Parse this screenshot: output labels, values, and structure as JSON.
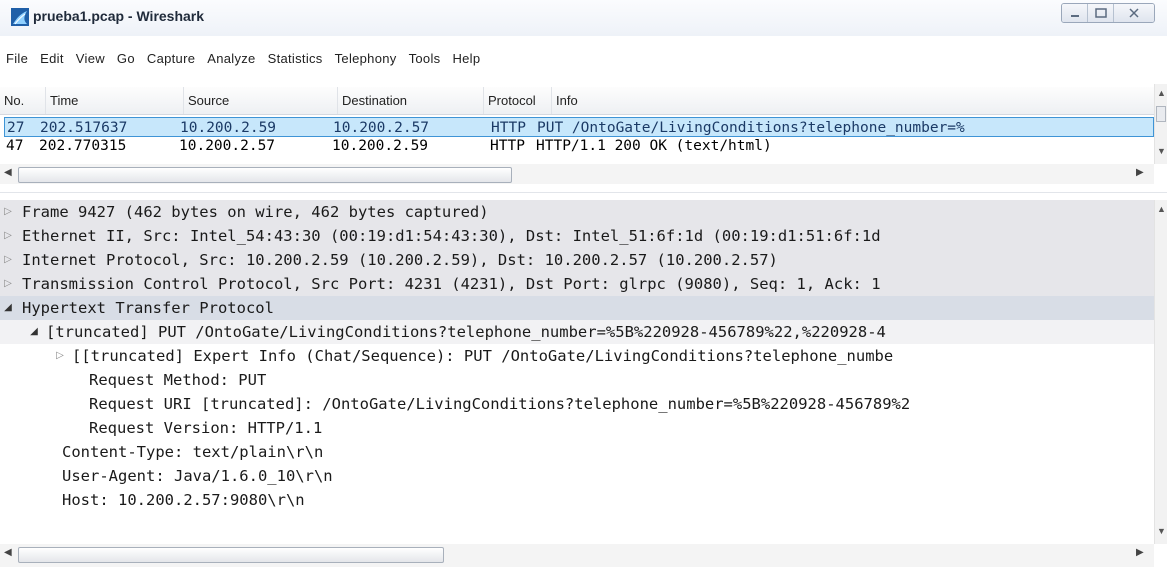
{
  "window": {
    "title": "prueba1.pcap - Wireshark",
    "app_icon": "wireshark-fin-icon",
    "controls": [
      "minimize-icon",
      "maximize-icon",
      "close-icon"
    ]
  },
  "menu": [
    "File",
    "Edit",
    "View",
    "Go",
    "Capture",
    "Analyze",
    "Statistics",
    "Telephony",
    "Tools",
    "Help"
  ],
  "packet_list": {
    "columns": [
      "No.",
      "Time",
      "Source",
      "Destination",
      "Protocol",
      "Info"
    ],
    "rows": [
      {
        "no": "27",
        "time": "202.517637",
        "source": "10.200.2.59",
        "destination": "10.200.2.57",
        "protocol": "HTTP",
        "info": "PUT /OntoGate/LivingConditions?telephone_number=%",
        "selected": true
      },
      {
        "no": "47",
        "time": "202.770315",
        "source": "10.200.2.57",
        "destination": "10.200.2.59",
        "protocol": "HTTP",
        "info": "HTTP/1.1 200 OK  (text/html)",
        "selected": false
      }
    ]
  },
  "details": [
    {
      "text": "Frame 9427 (462 bytes on wire, 462 bytes captured)",
      "toggle": "closed"
    },
    {
      "text": "Ethernet II, Src: Intel_54:43:30 (00:19:d1:54:43:30), Dst: Intel_51:6f:1d (00:19:d1:51:6f:1d",
      "toggle": "closed"
    },
    {
      "text": "Internet Protocol, Src: 10.200.2.59 (10.200.2.59), Dst: 10.200.2.57 (10.200.2.57)",
      "toggle": "closed"
    },
    {
      "text": "Transmission Control Protocol, Src Port: 4231 (4231), Dst Port: glrpc (9080), Seq: 1, Ack: 1",
      "toggle": "closed"
    },
    {
      "text": "Hypertext Transfer Protocol",
      "toggle": "open"
    },
    {
      "text": "[truncated] PUT /OntoGate/LivingConditions?telephone_number=%5B%220928-456789%22,%220928-4",
      "toggle": "open"
    },
    {
      "text": "[[truncated] Expert Info (Chat/Sequence): PUT /OntoGate/LivingConditions?telephone_numbe",
      "toggle": "closed"
    },
    {
      "text": "Request Method: PUT",
      "toggle": "none"
    },
    {
      "text": "Request URI [truncated]: /OntoGate/LivingConditions?telephone_number=%5B%220928-456789%2",
      "toggle": "none"
    },
    {
      "text": "Request Version: HTTP/1.1",
      "toggle": "none"
    },
    {
      "text": "Content-Type: text/plain\\r\\n",
      "toggle": "none"
    },
    {
      "text": "User-Agent: Java/1.6.0_10\\r\\n",
      "toggle": "none"
    },
    {
      "text": "Host: 10.200.2.57:9080\\r\\n",
      "toggle": "none"
    }
  ]
}
